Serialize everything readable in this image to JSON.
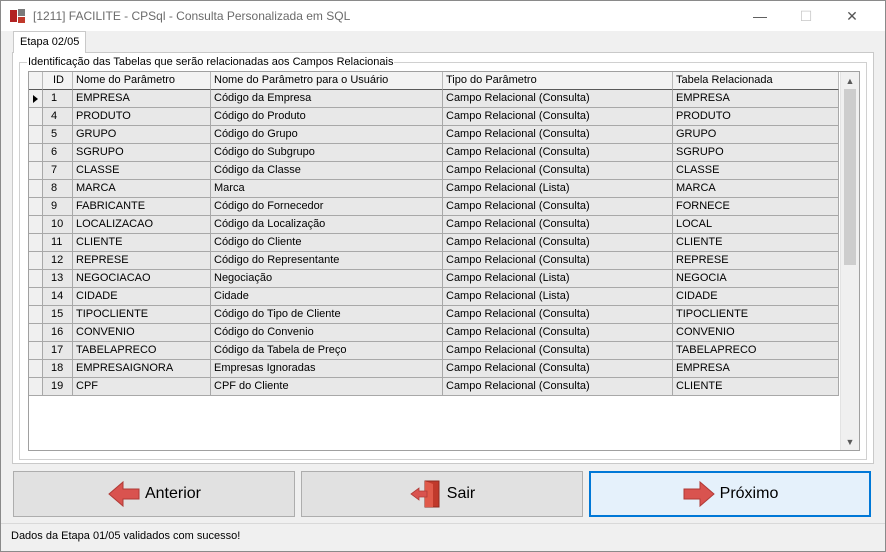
{
  "window": {
    "title": "[1211] FACILITE - CPSql - Consulta Personalizada em SQL",
    "controls": {
      "minimize": "—",
      "maximize": "☐",
      "close": "✕"
    }
  },
  "tab": {
    "label": "Etapa 02/05"
  },
  "group": {
    "label": "Identificação das Tabelas que serão relacionadas aos Campos Relacionais"
  },
  "grid": {
    "headers": [
      "ID",
      "Nome do Parâmetro",
      "Nome do Parâmetro para o Usuário",
      "Tipo do Parâmetro",
      "Tabela Relacionada"
    ],
    "rows": [
      {
        "id": "1",
        "nome": "EMPRESA",
        "usuario": "Código da Empresa",
        "tipo": "Campo Relacional (Consulta)",
        "tabela": "EMPRESA"
      },
      {
        "id": "4",
        "nome": "PRODUTO",
        "usuario": "Código do Produto",
        "tipo": "Campo Relacional (Consulta)",
        "tabela": "PRODUTO"
      },
      {
        "id": "5",
        "nome": "GRUPO",
        "usuario": "Código do Grupo",
        "tipo": "Campo Relacional (Consulta)",
        "tabela": "GRUPO"
      },
      {
        "id": "6",
        "nome": "SGRUPO",
        "usuario": "Código do Subgrupo",
        "tipo": "Campo Relacional (Consulta)",
        "tabela": "SGRUPO"
      },
      {
        "id": "7",
        "nome": "CLASSE",
        "usuario": "Código da Classe",
        "tipo": "Campo Relacional (Consulta)",
        "tabela": "CLASSE"
      },
      {
        "id": "8",
        "nome": "MARCA",
        "usuario": "Marca",
        "tipo": "Campo Relacional (Lista)",
        "tabela": "MARCA"
      },
      {
        "id": "9",
        "nome": "FABRICANTE",
        "usuario": "Código do Fornecedor",
        "tipo": "Campo Relacional (Consulta)",
        "tabela": "FORNECE"
      },
      {
        "id": "10",
        "nome": "LOCALIZACAO",
        "usuario": "Código da Localização",
        "tipo": "Campo Relacional (Consulta)",
        "tabela": "LOCAL"
      },
      {
        "id": "11",
        "nome": "CLIENTE",
        "usuario": "Código do Cliente",
        "tipo": "Campo Relacional (Consulta)",
        "tabela": "CLIENTE"
      },
      {
        "id": "12",
        "nome": "REPRESE",
        "usuario": "Código do Representante",
        "tipo": "Campo Relacional (Consulta)",
        "tabela": "REPRESE"
      },
      {
        "id": "13",
        "nome": "NEGOCIACAO",
        "usuario": "Negociação",
        "tipo": "Campo Relacional (Lista)",
        "tabela": "NEGOCIA"
      },
      {
        "id": "14",
        "nome": "CIDADE",
        "usuario": "Cidade",
        "tipo": "Campo Relacional (Lista)",
        "tabela": "CIDADE"
      },
      {
        "id": "15",
        "nome": "TIPOCLIENTE",
        "usuario": "Código do Tipo de Cliente",
        "tipo": "Campo Relacional (Consulta)",
        "tabela": "TIPOCLIENTE"
      },
      {
        "id": "16",
        "nome": "CONVENIO",
        "usuario": "Código do Convenio",
        "tipo": "Campo Relacional (Consulta)",
        "tabela": "CONVENIO"
      },
      {
        "id": "17",
        "nome": "TABELAPRECO",
        "usuario": "Código da Tabela de Preço",
        "tipo": "Campo Relacional (Consulta)",
        "tabela": "TABELAPRECO"
      },
      {
        "id": "18",
        "nome": "EMPRESAIGNORA",
        "usuario": "Empresas Ignoradas",
        "tipo": "Campo Relacional (Consulta)",
        "tabela": "EMPRESA"
      },
      {
        "id": "19",
        "nome": "CPF",
        "usuario": "CPF do Cliente",
        "tipo": "Campo Relacional (Consulta)",
        "tabela": "CLIENTE"
      }
    ]
  },
  "buttons": {
    "anterior": "Anterior",
    "sair": "Sair",
    "proximo": "Próximo"
  },
  "icons": {
    "anterior": "arrow-left-icon",
    "sair": "exit-door-icon",
    "proximo": "arrow-right-icon"
  },
  "colors": {
    "accent": "#0078d7",
    "arrow": "#d9534f"
  },
  "status": {
    "text": "Dados da Etapa 01/05 validados com sucesso!"
  }
}
